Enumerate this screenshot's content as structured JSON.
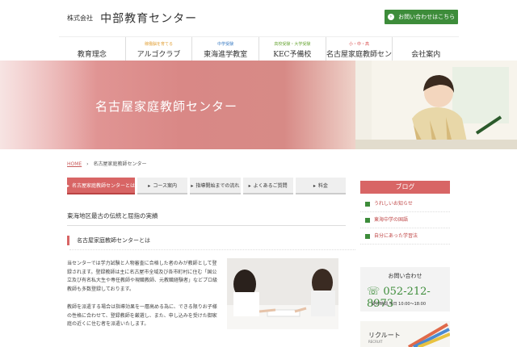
{
  "header": {
    "company_prefix": "株式会社",
    "company_name": "中部教育センター",
    "contact_button": "お問い合わせはこちら"
  },
  "nav": [
    {
      "tag": "",
      "label": "教育理念",
      "tag_color": "#999999"
    },
    {
      "tag": "稼働脳を育てる",
      "label": "アルゴクラブ",
      "tag_color": "#e2a23a"
    },
    {
      "tag": "中学受験",
      "label": "東海進学教室",
      "tag_color": "#3a7cc4"
    },
    {
      "tag": "高校受験・大学受験",
      "label": "KEC予備校",
      "tag_color": "#6aa636"
    },
    {
      "tag": "小・中・高",
      "label": "名古屋家庭教師センター",
      "tag_color": "#d84a4a"
    },
    {
      "tag": "",
      "label": "会社案内",
      "tag_color": "#999999"
    }
  ],
  "hero": {
    "title": "名古屋家庭教師センター"
  },
  "breadcrumb": {
    "home": "HOME",
    "current": "名古屋家庭教師センター"
  },
  "tabs": [
    {
      "label": "名古屋家庭教師センターとは",
      "active": true
    },
    {
      "label": "コース案内",
      "active": false
    },
    {
      "label": "指導開始までの流れ",
      "active": false
    },
    {
      "label": "よくあるご質問",
      "active": false
    },
    {
      "label": "料金",
      "active": false
    }
  ],
  "main": {
    "heading": "東海地区最古の伝統と屈指の実績",
    "subheading": "名古屋家庭教師センターとは",
    "paragraph1": "当センターでは学力試験と人物審査に合格した者のみが教師として登録されます。登録教師は主に名古屋市全域及び各市町村に住む「国公立及び有名私大生や専任教師や現職教師、元教職経験者」などプロ級教師も多数登録しております。",
    "paragraph2": "教師を派遣する場合は指導効果を一層高める為に、できる限りお子様の性格に合わせて、登録教師を厳選し、また、申し込みを受けた御家庭の近くに住む者を派遣いたします。"
  },
  "sidebar": {
    "blog_title": "ブログ",
    "blog_items": [
      "うれしいお知らせ",
      "東海中学の国語",
      "自分にあった学習法"
    ],
    "contact_title": "お問い合わせ",
    "phone": "052-212-8973",
    "hours": "受付時間 平日 10:00～18:00",
    "recruit_title": "リクルート",
    "recruit_sub": "RECRUIT"
  },
  "colors": {
    "accent": "#d86565",
    "green": "#3d8c3a"
  }
}
